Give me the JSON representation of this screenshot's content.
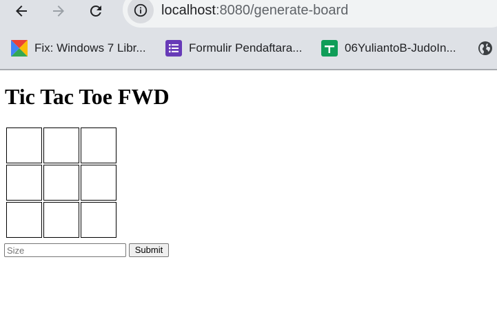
{
  "browser": {
    "url_host": "localhost",
    "url_rest": ":8080/generate-board",
    "bookmarks": [
      {
        "label": "Fix: Windows 7 Libr...",
        "icon": "colorful-square-icon"
      },
      {
        "label": "Formulir Pendaftara...",
        "icon": "forms-icon"
      },
      {
        "label": "06YuliantoB-JudoIn...",
        "icon": "sheets-icon"
      },
      {
        "label": "",
        "icon": "globe-icon"
      }
    ]
  },
  "page": {
    "title": "Tic Tac Toe FWD",
    "board": {
      "rows": 3,
      "cols": 3,
      "cells": [
        [
          "",
          "",
          ""
        ],
        [
          "",
          "",
          ""
        ],
        [
          "",
          "",
          ""
        ]
      ]
    },
    "size_input": {
      "value": "",
      "placeholder": "Size"
    },
    "submit_label": "Submit"
  },
  "colors": {
    "chrome_background": "#dee1e6",
    "omnibox": "#f1f3f4",
    "forms_purple": "#673ab7",
    "sheets_green": "#0f9d58"
  }
}
